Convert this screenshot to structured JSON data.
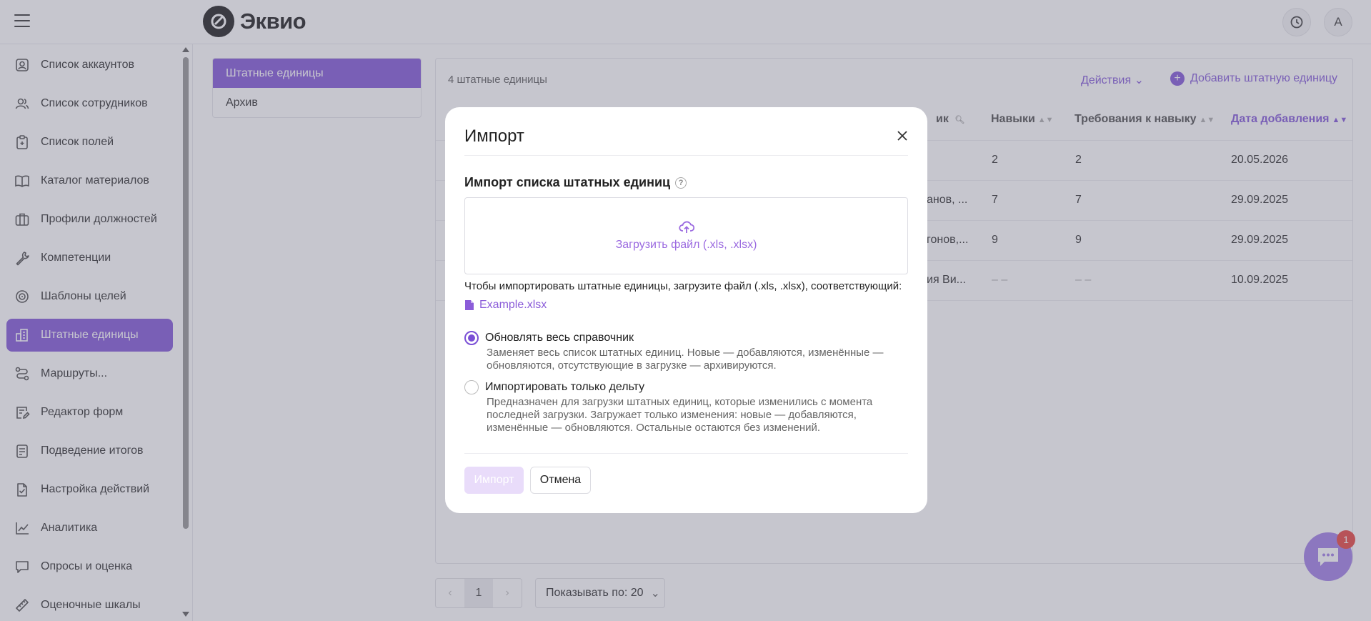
{
  "app": {
    "logo_text": "Эквио",
    "avatar_letter": "А"
  },
  "sidebar": {
    "items": [
      {
        "label": "Список аккаунтов",
        "icon": "account-icon"
      },
      {
        "label": "Список сотрудников",
        "icon": "users-icon"
      },
      {
        "label": "Список полей",
        "icon": "clipboard-icon"
      },
      {
        "label": "Каталог материалов",
        "icon": "book-icon"
      },
      {
        "label": "Профили должностей",
        "icon": "briefcase-icon"
      },
      {
        "label": "Компетенции",
        "icon": "wrench-icon"
      },
      {
        "label": "Шаблоны целей",
        "icon": "target-icon"
      },
      {
        "label": "Штатные единицы",
        "icon": "building-icon",
        "active": true
      },
      {
        "label": "Маршруты...",
        "icon": "route-icon"
      },
      {
        "label": "Редактор форм",
        "icon": "form-edit-icon"
      },
      {
        "label": "Подведение итогов",
        "icon": "summary-icon"
      },
      {
        "label": "Настройка действий",
        "icon": "checklist-icon"
      },
      {
        "label": "Аналитика",
        "icon": "chart-line-icon"
      },
      {
        "label": "Опросы и оценка",
        "icon": "chat-icon"
      },
      {
        "label": "Оценочные шкалы",
        "icon": "ruler-icon"
      }
    ]
  },
  "tabs": [
    {
      "label": "Штатные единицы",
      "active": true
    },
    {
      "label": "Архив",
      "active": false
    }
  ],
  "table": {
    "count_label": "4 штатные единицы",
    "actions_label": "Действия",
    "add_label": "Добавить штатную единицу",
    "columns": [
      "ик",
      "Навыки",
      "Требования к навыку",
      "Дата добавления"
    ],
    "rows": [
      {
        "name": "",
        "skills": "2",
        "requirements": "2",
        "date": "20.05.2026"
      },
      {
        "name": "анов, ...",
        "skills": "7",
        "requirements": "7",
        "date": "29.09.2025"
      },
      {
        "name": "гонов,...",
        "skills": "9",
        "requirements": "9",
        "date": "29.09.2025"
      },
      {
        "name": "ия Ви...",
        "skills": "– –",
        "requirements": "– –",
        "date": "10.09.2025"
      }
    ]
  },
  "pagination": {
    "current_page": "1",
    "per_page_label": "Показывать по: 20"
  },
  "chat": {
    "badge": "1"
  },
  "modal": {
    "title": "Импорт",
    "subtitle": "Импорт списка штатных единиц",
    "dropzone_label": "Загрузить файл (.xls, .xlsx)",
    "hint": "Чтобы импортировать штатные единицы, загрузите файл (.xls, .xlsx), соответствующий:",
    "example_file": "Example.xlsx",
    "options": [
      {
        "title": "Обновлять весь справочник",
        "description_lines": [
          "Заменяет весь список штатных единиц. Новые — добавляются, изменённые —",
          "обновляются, отсутствующие в загрузке — архивируются."
        ],
        "selected": true
      },
      {
        "title": "Импортировать только дельту",
        "description_lines": [
          "Предназначен для загрузки штатных единиц, которые изменились с момента",
          "последней загрузки. Загружает только изменения: новые — добавляются,",
          "изменённые — обновляются. Остальные остаются без изменений."
        ],
        "selected": false
      }
    ],
    "import_button": "Импорт",
    "cancel_button": "Отмена"
  },
  "colors": {
    "accent": "#7a4fd6",
    "accent_light": "#e9dcfa",
    "badge_red": "#e53935"
  }
}
